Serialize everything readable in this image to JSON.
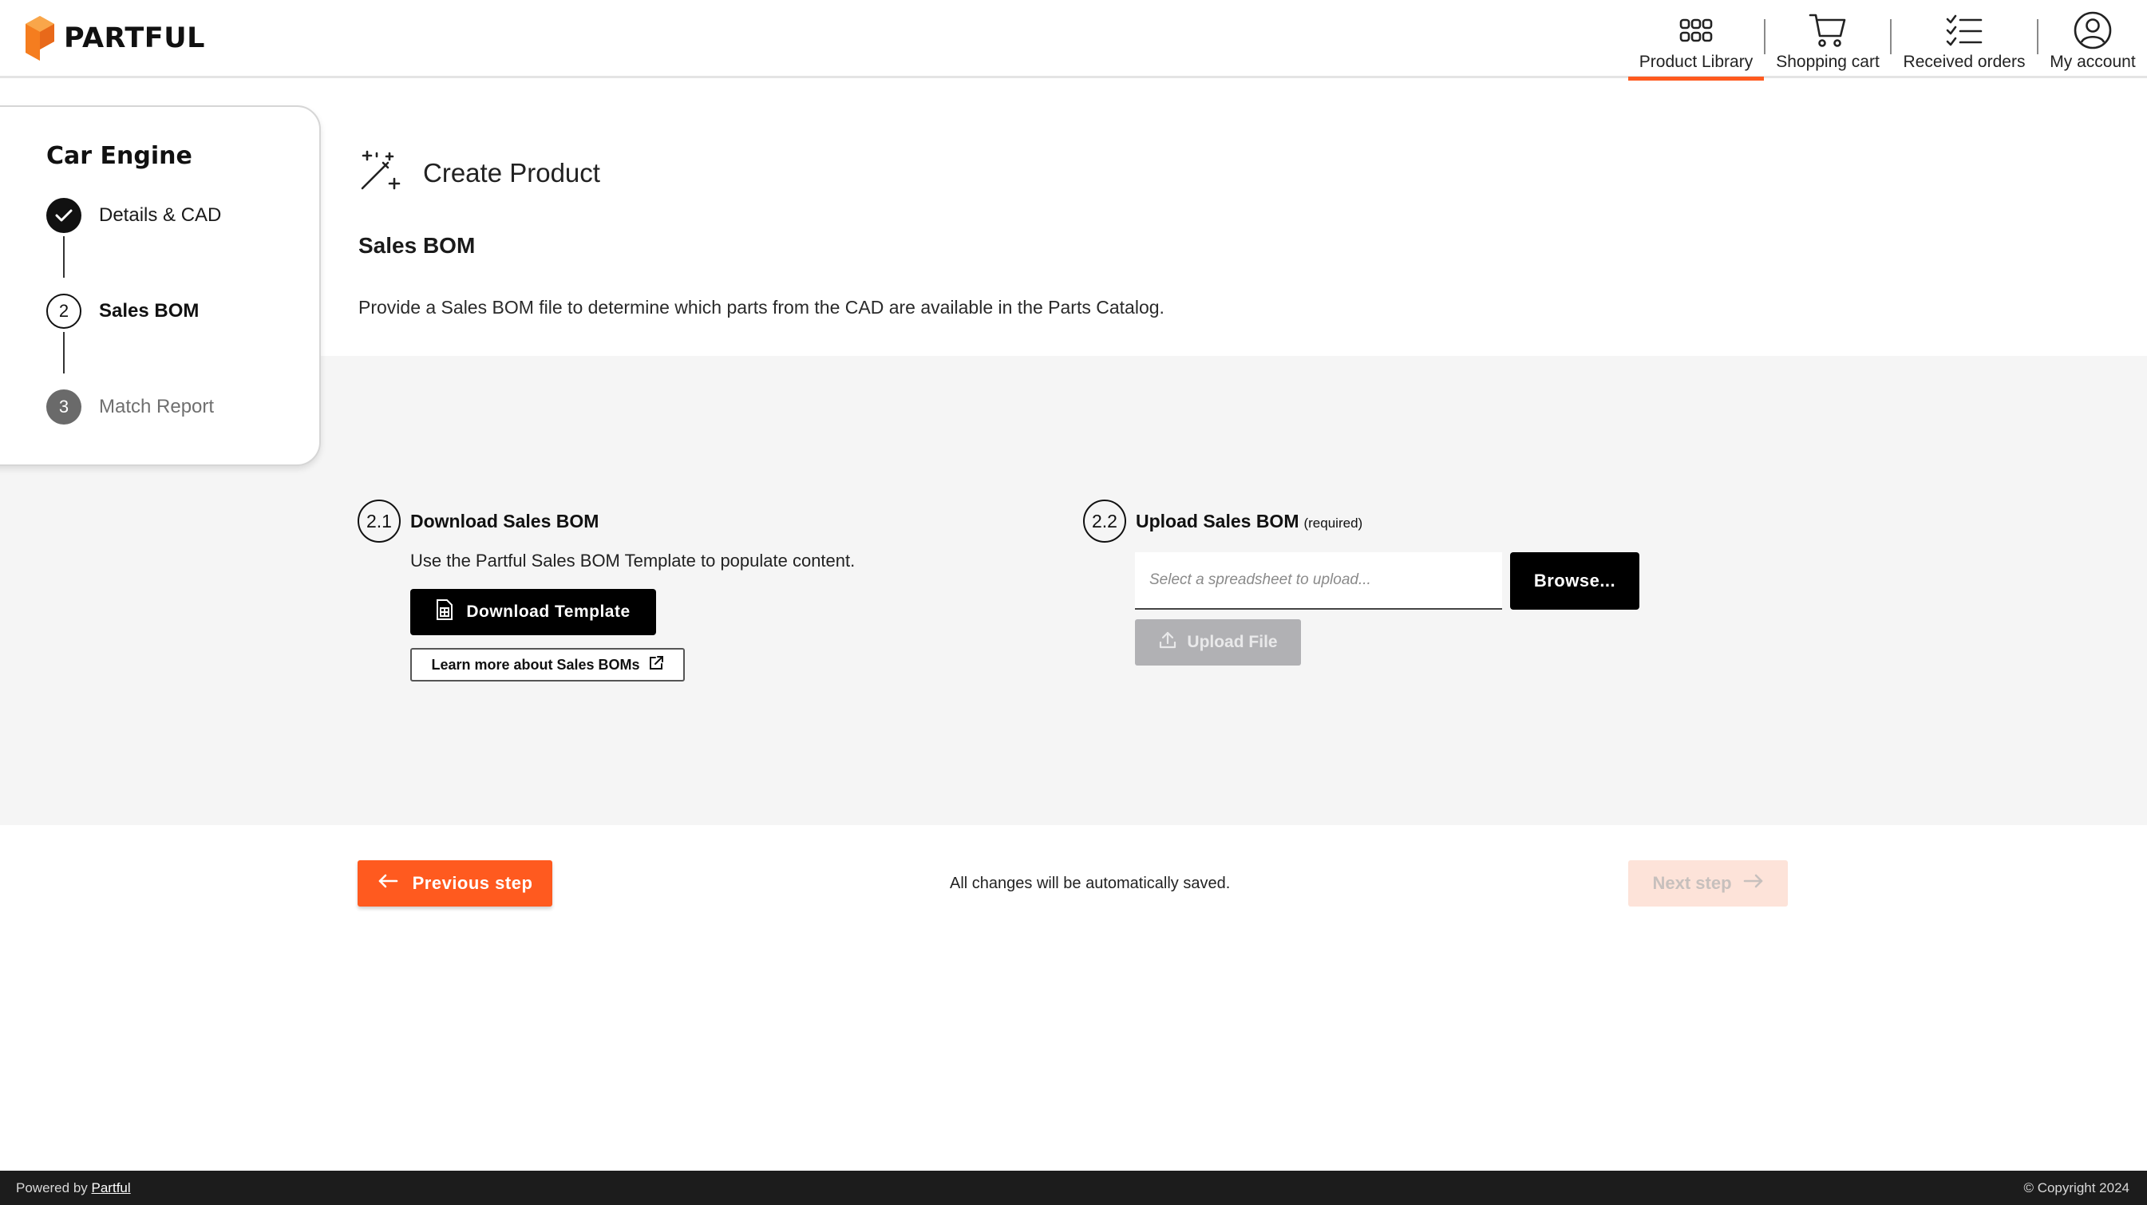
{
  "brand": {
    "name": "PARTFUL",
    "accent_color": "#ff5a1f"
  },
  "nav": {
    "items": [
      {
        "label": "Product Library",
        "icon": "grid-icon",
        "active": true
      },
      {
        "label": "Shopping cart",
        "icon": "cart-icon"
      },
      {
        "label": "Received orders",
        "icon": "checklist-icon"
      },
      {
        "label": "My account",
        "icon": "user-icon"
      }
    ]
  },
  "stepper": {
    "title": "Car Engine",
    "steps": [
      {
        "number": "1",
        "label": "Details & CAD",
        "state": "completed"
      },
      {
        "number": "2",
        "label": "Sales BOM",
        "state": "current"
      },
      {
        "number": "3",
        "label": "Match Report",
        "state": "upcoming"
      }
    ]
  },
  "page": {
    "title": "Create Product",
    "section_title": "Sales BOM",
    "section_desc": "Provide a Sales BOM file to determine which parts from the CAD are available in the Parts Catalog."
  },
  "download": {
    "number": "2.1",
    "title": "Download Sales BOM",
    "desc": "Use the Partful Sales BOM Template to populate content.",
    "button": "Download Template",
    "link": "Learn more about Sales BOMs"
  },
  "upload": {
    "number": "2.2",
    "title": "Upload Sales BOM",
    "required": "(required)",
    "placeholder": "Select a spreadsheet to upload...",
    "browse": "Browse...",
    "upload_button": "Upload File"
  },
  "actions": {
    "previous": "Previous step",
    "autosave": "All changes will be automatically saved.",
    "next": "Next step"
  },
  "footer": {
    "powered_prefix": "Powered by",
    "powered_link": "Partful",
    "copyright": "© Copyright 2024"
  }
}
